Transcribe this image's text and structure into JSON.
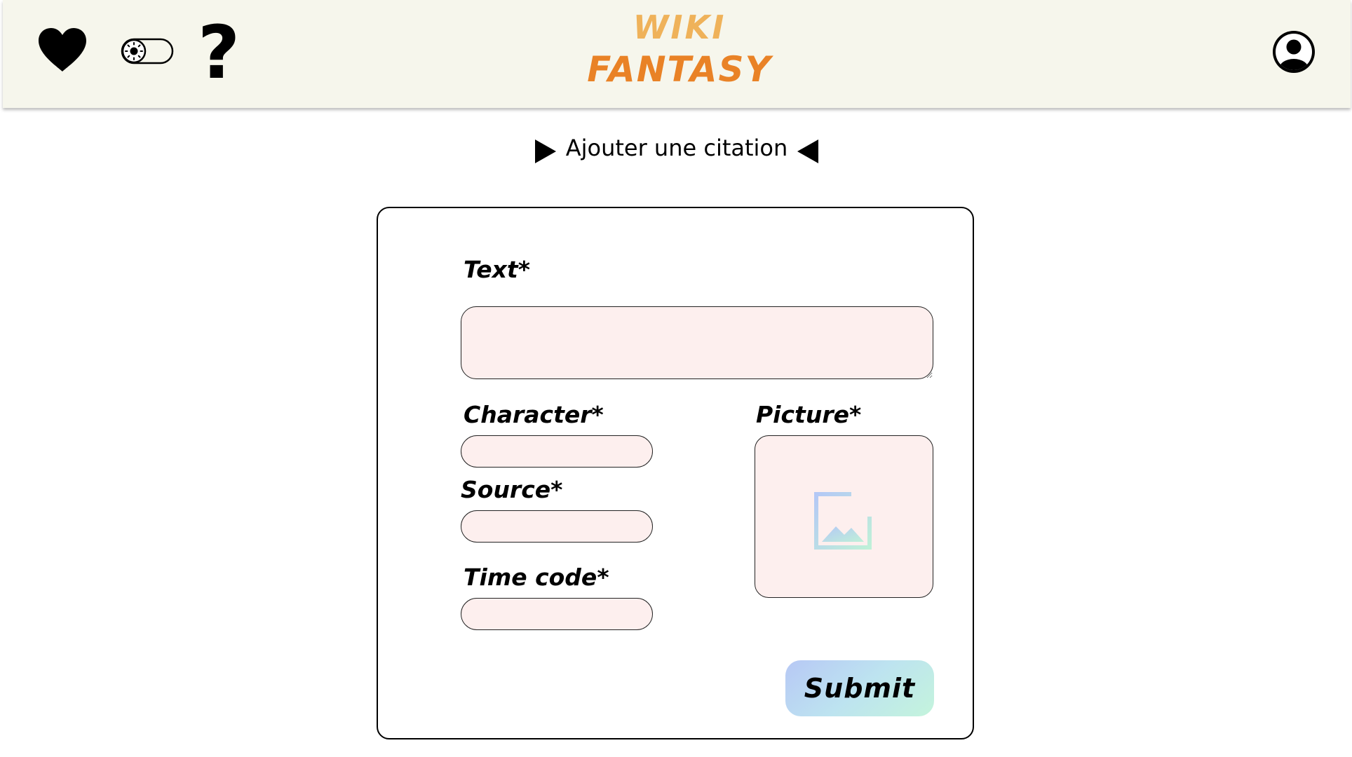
{
  "header": {
    "logo_line1": "WIKI",
    "logo_line2": "FANTASY",
    "logo_colors": {
      "line1": "#efb25a",
      "line2": "#e98226"
    },
    "background": "#f6f6ec",
    "icons": {
      "favorites": "heart-icon",
      "theme": "theme-toggle-sun-icon",
      "help": "question-mark-icon",
      "profile": "user-account-icon"
    },
    "help_glyph": "?"
  },
  "page": {
    "heading": "Ajouter une citation"
  },
  "form": {
    "text_label": "Text*",
    "character_label": "Character*",
    "source_label": "Source*",
    "timecode_label": "Time code*",
    "picture_label": "Picture*",
    "picture_icon": "add-image-icon",
    "submit_label": "Submit",
    "field_background": "#fdefee",
    "text_value": "",
    "character_value": "",
    "source_value": "",
    "timecode_value": ""
  }
}
